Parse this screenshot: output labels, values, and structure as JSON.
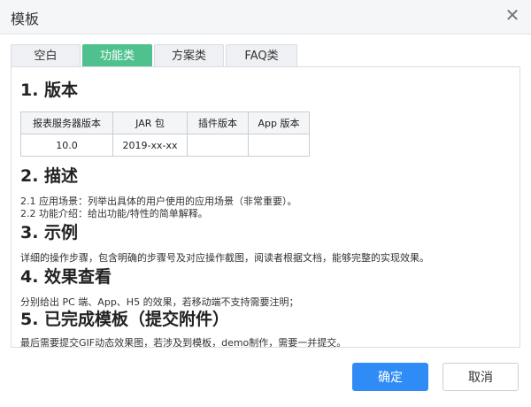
{
  "dialog": {
    "title": "模板"
  },
  "tabs": [
    {
      "label": "空白"
    },
    {
      "label": "功能类",
      "active": true
    },
    {
      "label": "方案类"
    },
    {
      "label": "FAQ类"
    }
  ],
  "sections": {
    "s1": {
      "heading": "1. 版本"
    },
    "s2": {
      "heading": "2. 描述",
      "line1": "2.1 应用场景：列举出具体的用户使用的应用场景（非常重要）。",
      "line2": "2.2 功能介绍：给出功能/特性的简单解释。"
    },
    "s3": {
      "heading": "3. 示例",
      "text": "详细的操作步骤，包含明确的步骤号及对应操作截图，阅读者根据文档，能够完整的实现效果。"
    },
    "s4": {
      "heading": "4. 效果查看",
      "text": "分别给出 PC 端、App、H5 的效果，若移动端不支持需要注明；"
    },
    "s5": {
      "heading": "5. 已完成模板（提交附件）",
      "text": "最后需要提交GIF动态效果图，若涉及到模板，demo制作，需要一并提交。"
    }
  },
  "version_table": {
    "headers": [
      "报表服务器版本",
      "JAR 包",
      "插件版本",
      "App 版本"
    ],
    "row": [
      "10.0",
      "2019-xx-xx",
      "",
      ""
    ]
  },
  "buttons": {
    "ok": "确定",
    "cancel": "取消"
  },
  "colors": {
    "active_tab": "#4ec18e",
    "primary": "#2f8cf6"
  }
}
